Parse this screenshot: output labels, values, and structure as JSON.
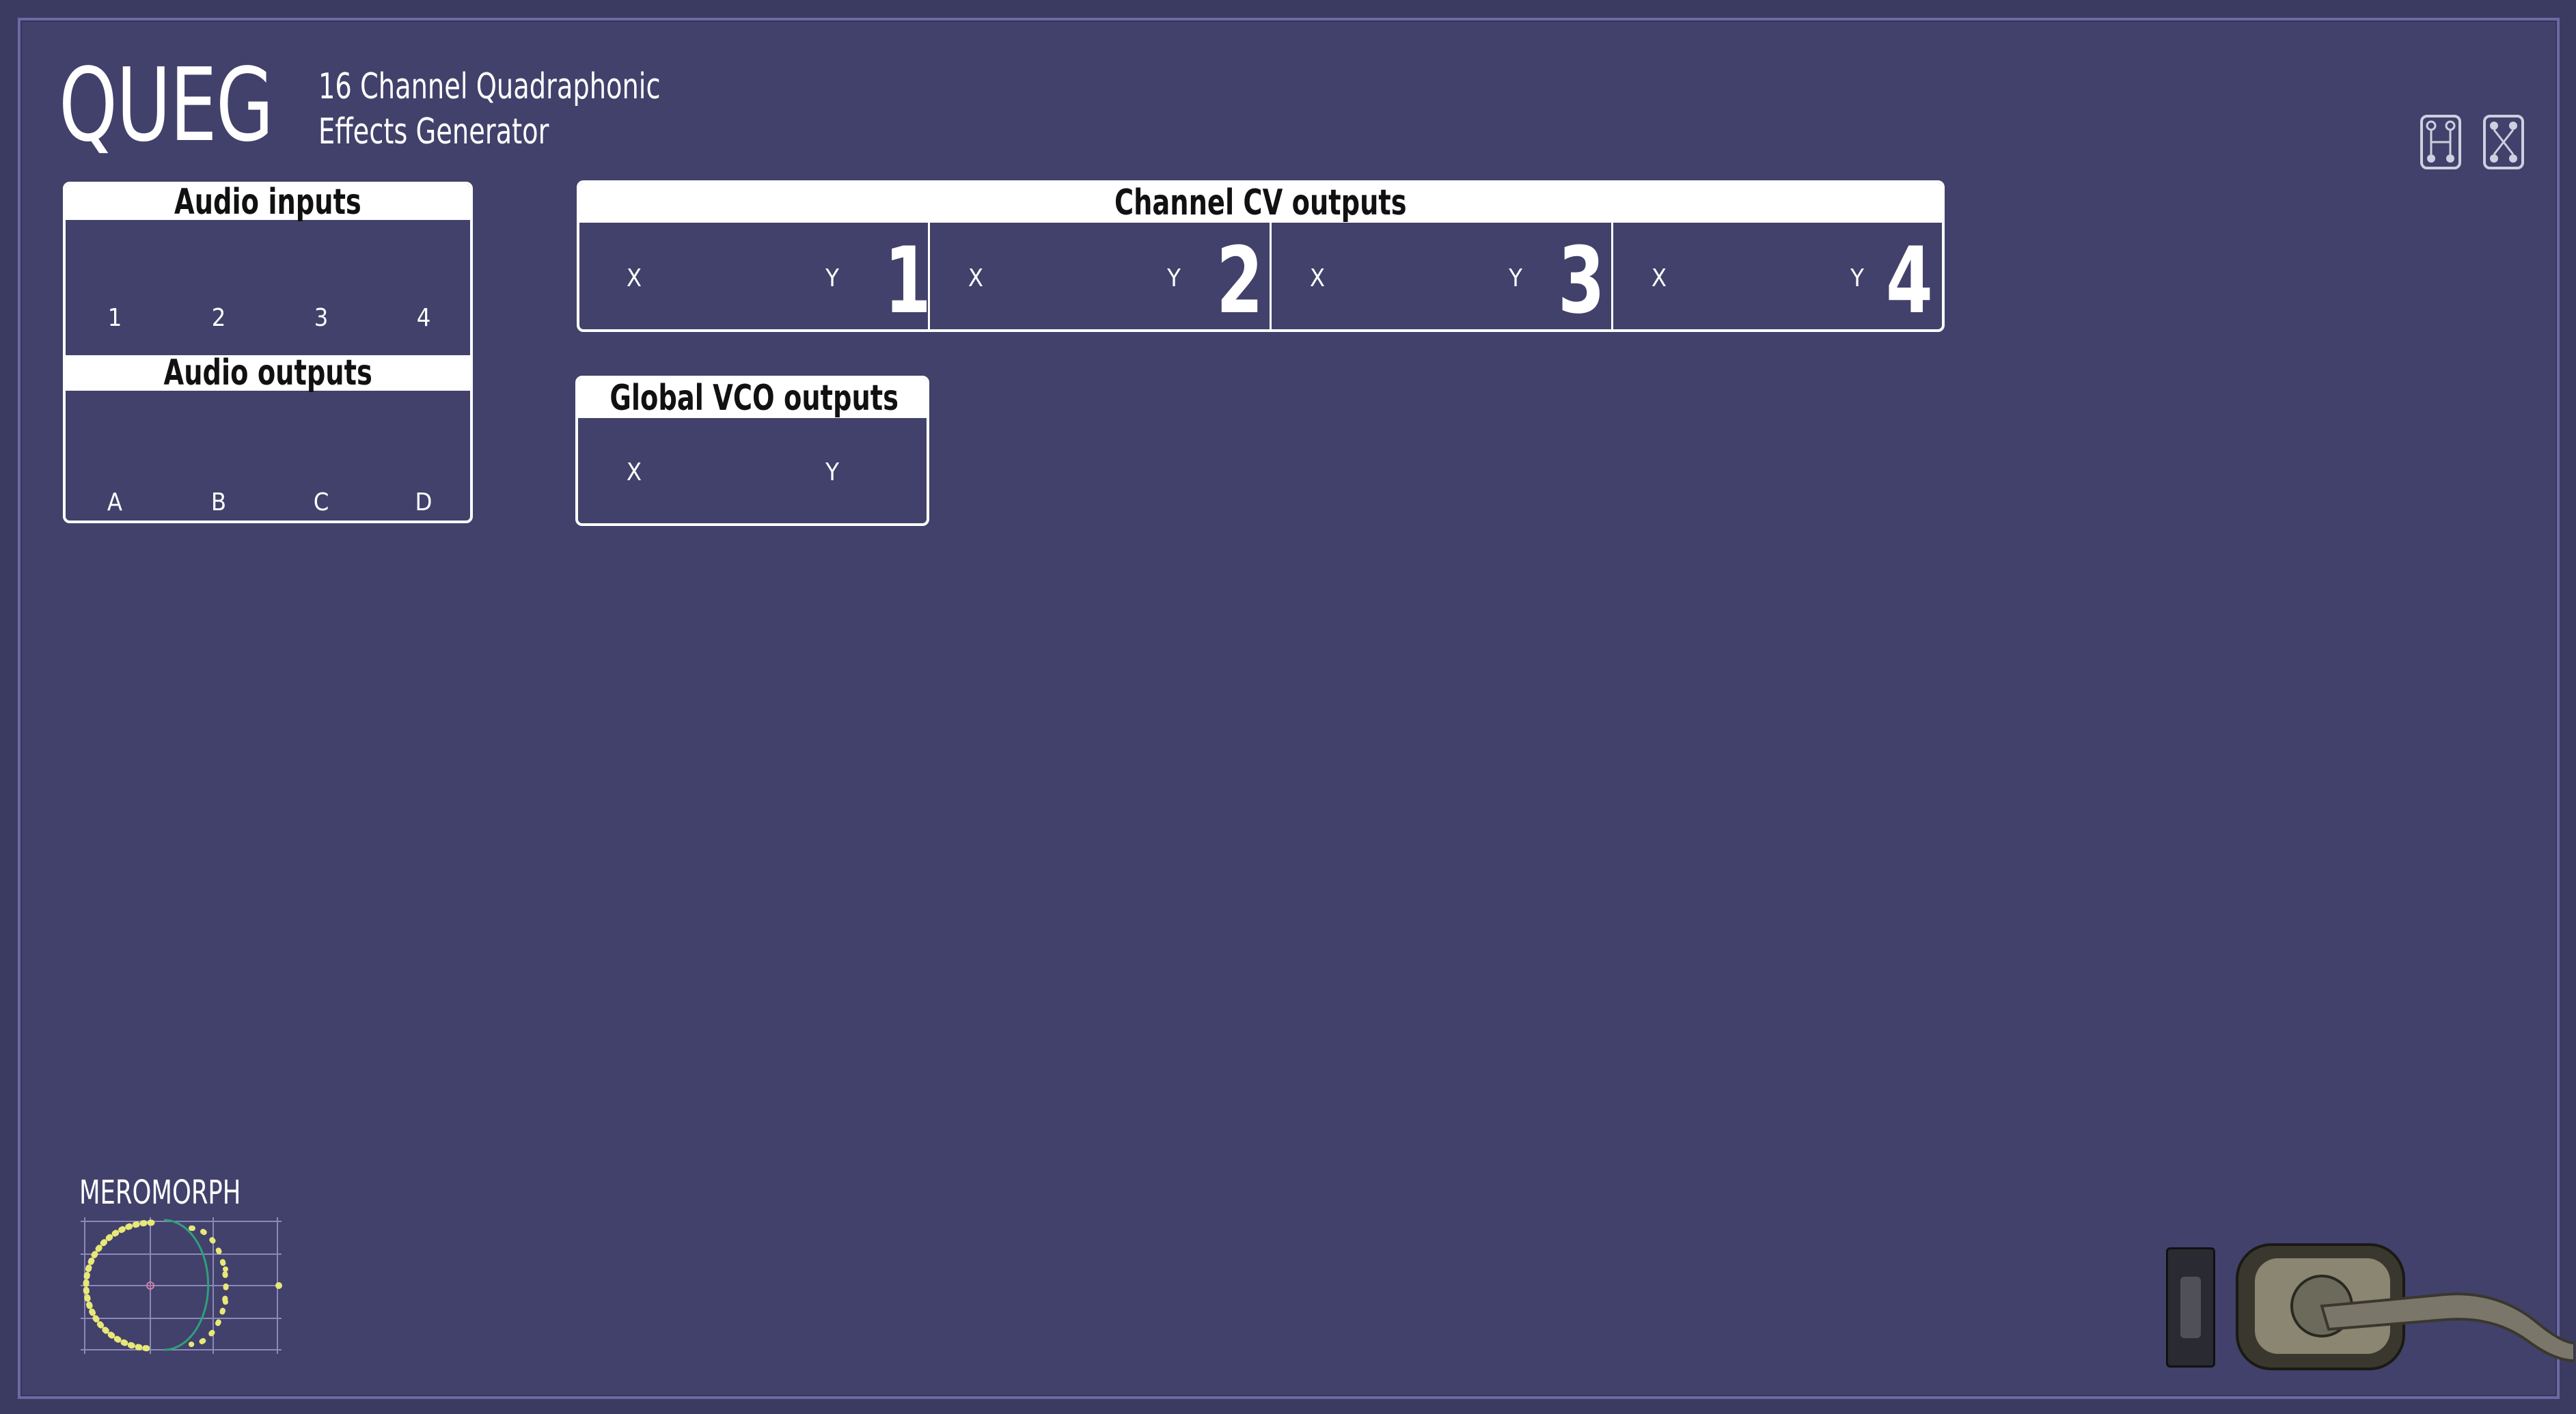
{
  "app": {
    "title": "QUEG",
    "subtitle_line1": "16 Channel Quadraphonic",
    "subtitle_line2": "Effects Generator",
    "brand": "MEROMORPH"
  },
  "audio_inputs": {
    "heading": "Audio inputs",
    "labels": [
      "1",
      "2",
      "3",
      "4"
    ]
  },
  "audio_outputs": {
    "heading": "Audio outputs",
    "labels": [
      "A",
      "B",
      "C",
      "D"
    ]
  },
  "channel_cv": {
    "heading": "Channel CV outputs",
    "channels": [
      {
        "x": "X",
        "y": "Y",
        "num": "1"
      },
      {
        "x": "X",
        "y": "Y",
        "num": "2"
      },
      {
        "x": "X",
        "y": "Y",
        "num": "3"
      },
      {
        "x": "X",
        "y": "Y",
        "num": "4"
      }
    ]
  },
  "global_vco": {
    "heading": "Global VCO outputs",
    "x": "X",
    "y": "Y"
  },
  "icons": [
    "layout-h-icon",
    "layout-tree-icon",
    "toggle-switch-icon",
    "door-handle-icon"
  ],
  "colors": {
    "panel": "#42416b",
    "border": "#6a6aa3",
    "text": "#ffffff"
  }
}
